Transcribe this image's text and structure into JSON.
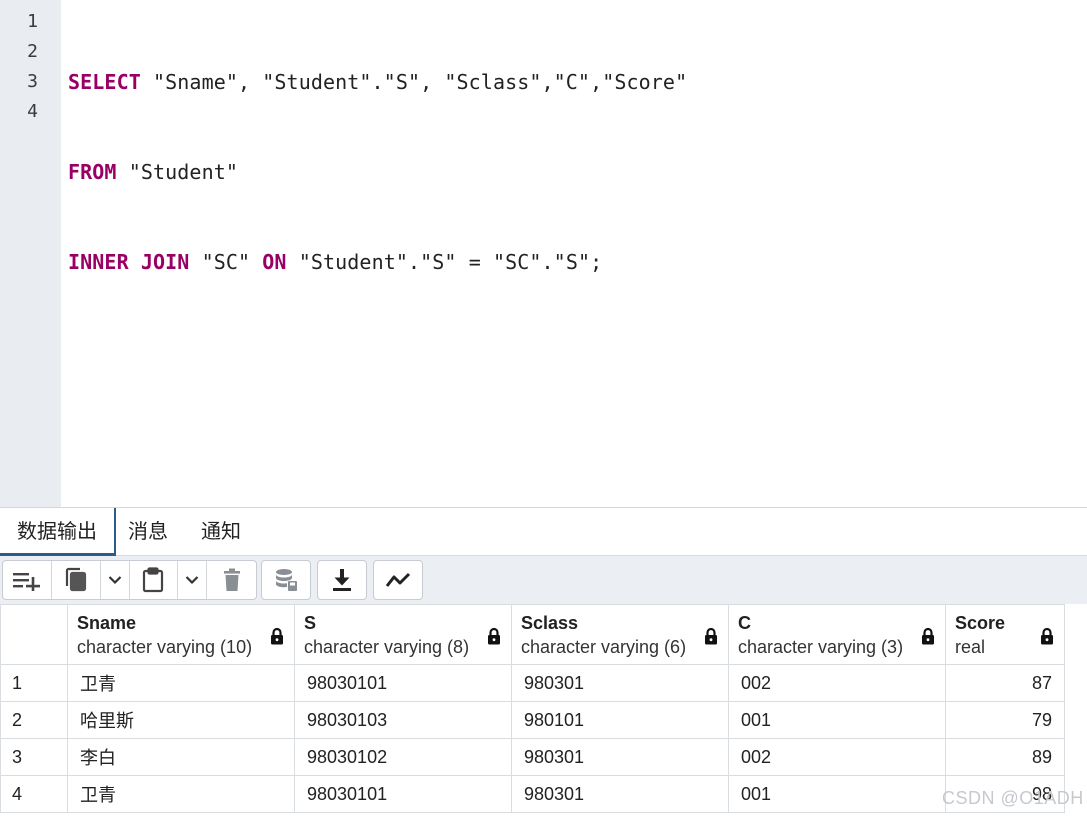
{
  "editor": {
    "line_numbers": [
      "1",
      "2",
      "3",
      "4"
    ],
    "lines": [
      [
        {
          "t": "SELECT",
          "kw": true
        },
        {
          "t": " \"Sname\", \"Student\".\"S\", \"Sclass\",\"C\",\"Score\"",
          "kw": false
        }
      ],
      [
        {
          "t": "FROM",
          "kw": true
        },
        {
          "t": " \"Student\"",
          "kw": false
        }
      ],
      [
        {
          "t": "INNER JOIN",
          "kw": true
        },
        {
          "t": " \"SC\" ",
          "kw": false
        },
        {
          "t": "ON",
          "kw": true
        },
        {
          "t": " \"Student\".\"S\" = \"SC\".\"S\";",
          "kw": false
        }
      ],
      []
    ]
  },
  "tabs": [
    "数据输出",
    "消息",
    "通知"
  ],
  "toolbar": {
    "icons": [
      "add-row-icon",
      "copy-icon",
      "chevron-down-icon",
      "paste-icon",
      "chevron-down-icon",
      "delete-icon",
      "save-data-icon",
      "download-icon",
      "graph-icon"
    ]
  },
  "grid": {
    "columns": [
      {
        "name": "Sname",
        "type": "character varying (10)"
      },
      {
        "name": "S",
        "type": "character varying (8)"
      },
      {
        "name": "Sclass",
        "type": "character varying (6)"
      },
      {
        "name": "C",
        "type": "character varying (3)"
      },
      {
        "name": "Score",
        "type": "real"
      }
    ],
    "rows": [
      {
        "n": "1",
        "cells": [
          "卫青",
          "98030101",
          "980301",
          "002",
          "87"
        ]
      },
      {
        "n": "2",
        "cells": [
          "哈里斯",
          "98030103",
          "980101",
          "001",
          "79"
        ]
      },
      {
        "n": "3",
        "cells": [
          "李白",
          "98030102",
          "980301",
          "002",
          "89"
        ]
      },
      {
        "n": "4",
        "cells": [
          "卫青",
          "98030101",
          "980301",
          "001",
          "98"
        ]
      }
    ]
  },
  "watermark": "CSDN @O1ADH",
  "colors": {
    "keyword": "#990066",
    "active_tab": "#2b5b8c",
    "gutter": "#e9ecf0",
    "toolbar_bg": "#ebeef2"
  }
}
